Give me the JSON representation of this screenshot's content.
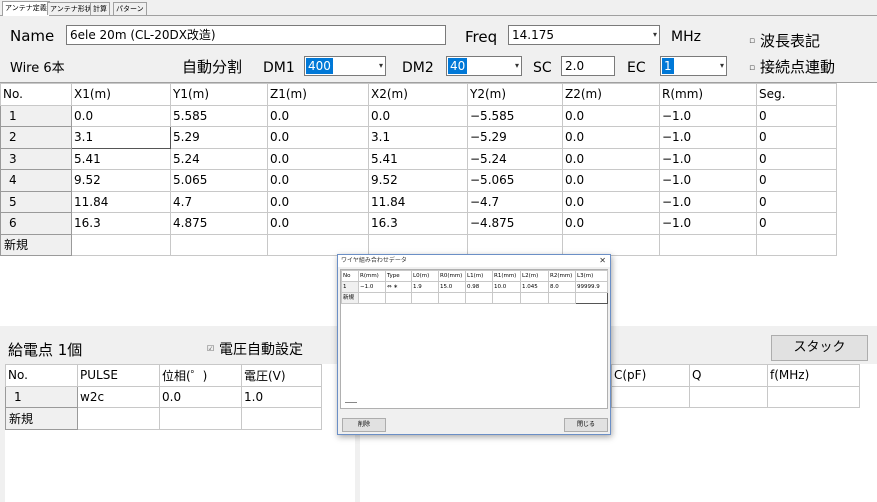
{
  "tabs": [
    "アンテナ定義",
    "アンテナ形状",
    "計算",
    "パターン"
  ],
  "name": {
    "label": "Name",
    "value": "6ele 20m (CL-20DX改造)"
  },
  "freq": {
    "label": "Freq",
    "value": "14.175",
    "unit": "MHz"
  },
  "wavelength_label": "波長表記",
  "wire_count": "Wire 6本",
  "auto_split": "自動分割",
  "dm1": {
    "label": "DM1",
    "value": "400"
  },
  "dm2": {
    "label": "DM2",
    "value": "40"
  },
  "sc": {
    "label": "SC",
    "value": "2.0"
  },
  "ec": {
    "label": "EC",
    "value": "1"
  },
  "connect_label": "接続点連動",
  "wire_table": {
    "headers": [
      "No.",
      "X1(m)",
      "Y1(m)",
      "Z1(m)",
      "X2(m)",
      "Y2(m)",
      "Z2(m)",
      "R(mm)",
      "Seg."
    ],
    "rows": [
      [
        "1",
        "0.0",
        "5.585",
        "0.0",
        "0.0",
        "−5.585",
        "0.0",
        "−1.0",
        "0"
      ],
      [
        "2",
        "3.1",
        "5.29",
        "0.0",
        "3.1",
        "−5.29",
        "0.0",
        "−1.0",
        "0"
      ],
      [
        "3",
        "5.41",
        "5.24",
        "0.0",
        "5.41",
        "−5.24",
        "0.0",
        "−1.0",
        "0"
      ],
      [
        "4",
        "9.52",
        "5.065",
        "0.0",
        "9.52",
        "−5.065",
        "0.0",
        "−1.0",
        "0"
      ],
      [
        "5",
        "11.84",
        "4.7",
        "0.0",
        "11.84",
        "−4.7",
        "0.0",
        "−1.0",
        "0"
      ],
      [
        "6",
        "16.3",
        "4.875",
        "0.0",
        "16.3",
        "−4.875",
        "0.0",
        "−1.0",
        "0"
      ]
    ],
    "new_row": "新規"
  },
  "feed": {
    "title": "給電点 1個",
    "auto_voltage": "電圧自動設定",
    "headers": [
      "No.",
      "PULSE",
      "位相(゜)",
      "電圧(V)"
    ],
    "rows": [
      [
        "1",
        "w2c",
        "0.0",
        "1.0"
      ]
    ],
    "new_row": "新規"
  },
  "load": {
    "stack_button": "スタック",
    "headers": [
      "C(pF)",
      "Q",
      "f(MHz)"
    ]
  },
  "dialog": {
    "title": "ワイヤ組み合わせデータ",
    "headers": [
      "No",
      "R(mm)",
      "Type",
      "L0(m)",
      "R0(mm)",
      "L1(m)",
      "R1(mm)",
      "L2(m)",
      "R2(mm)",
      "L3(m)"
    ],
    "rows": [
      [
        "1",
        "−1.0",
        "⇔ ∗",
        "1.9",
        "15.0",
        "0.98",
        "10.0",
        "1.045",
        "8.0",
        "99999.9"
      ]
    ],
    "new_row": "新規",
    "delete_button": "削除",
    "close_button": "閉じる"
  }
}
